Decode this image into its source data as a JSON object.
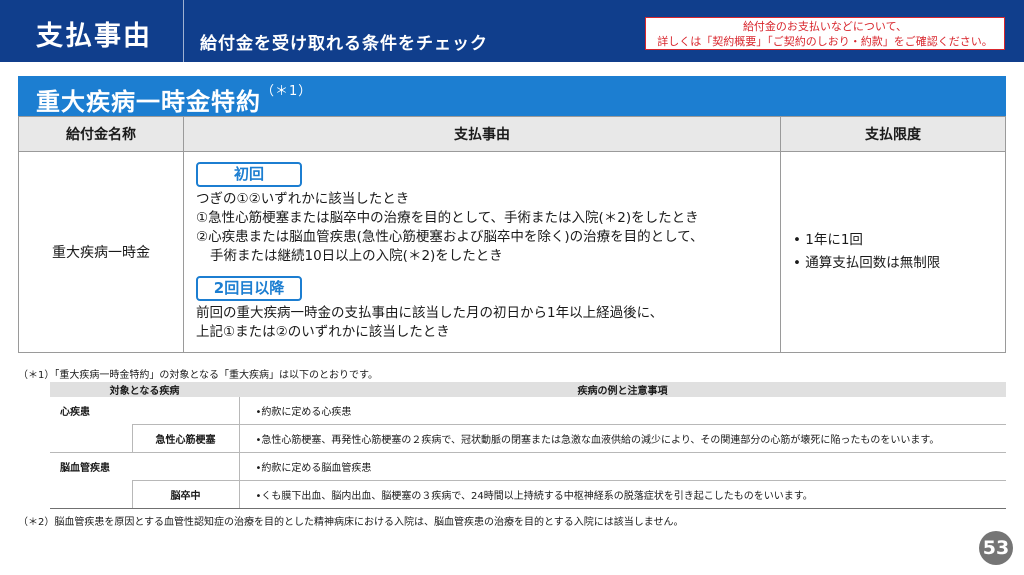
{
  "header": {
    "title": "支払事由",
    "subtitle": "給付金を受け取れる条件をチェック",
    "notice_line1": "給付金のお支払いなどについて、",
    "notice_line2": "詳しくは「契約概要」「ご契約のしおり・約款」をご確認ください。"
  },
  "section": {
    "title": "重大疾病一時金特約",
    "title_note": "（＊1）"
  },
  "main_table": {
    "headers": [
      "給付金名称",
      "支払事由",
      "支払限度"
    ],
    "benefit_name": "重大疾病一時金",
    "first_badge": "初回",
    "first_lines": [
      "つぎの①②いずれかに該当したとき",
      "①急性心筋梗塞または脳卒中の治療を目的として、手術または入院(＊2)をしたとき",
      "②心疾患または脳血管疾患(急性心筋梗塞および脳卒中を除く)の治療を目的として、",
      "手術または継続10日以上の入院(＊2)をしたとき"
    ],
    "second_badge": "2回目以降",
    "second_lines": [
      "前回の重大疾病一時金の支払事由に該当した月の初日から1年以上経過後に、",
      "上記①または②のいずれかに該当したとき"
    ],
    "limits": [
      "• 1年に1回",
      "• 通算支払回数は無制限"
    ]
  },
  "note1": "（＊1）「重大疾病一時金特約」の対象となる「重大疾病」は以下のとおりです。",
  "sub_table": {
    "headers": [
      "対象となる疾病",
      "疾病の例と注意事項"
    ],
    "rows": [
      {
        "disease": "心疾患",
        "sub": "",
        "example": "•約款に定める心疾患"
      },
      {
        "disease": "",
        "sub": "急性心筋梗塞",
        "example": "•急性心筋梗塞、再発性心筋梗塞の２疾病で、冠状動脈の閉塞または急激な血液供給の減少により、その関連部分の心筋が壊死に陥ったものをいいます。"
      },
      {
        "disease": "脳血管疾患",
        "sub": "",
        "example": "•約款に定める脳血管疾患"
      },
      {
        "disease": "",
        "sub": "脳卒中",
        "example": "•くも膜下出血、脳内出血、脳梗塞の３疾病で、24時間以上持続する中枢神経系の脱落症状を引き起こしたものをいいます。"
      }
    ]
  },
  "note2": "（＊2）脳血管疾患を原因とする血管性認知症の治療を目的とした精神病床における入院は、脳血管疾患の治療を目的とする入院には該当しません。",
  "page_number": "53",
  "colors": {
    "header_bg": "#103e8c",
    "section_bg": "#1c7ed1",
    "notice_red": "#d8262d",
    "badge_blue": "#1c7ed1"
  }
}
